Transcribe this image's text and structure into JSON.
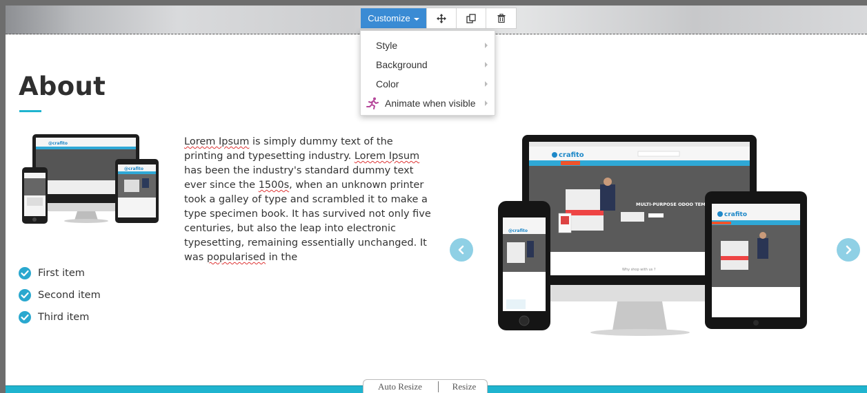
{
  "toolbar": {
    "customize_label": "Customize",
    "move_icon": "move-icon",
    "duplicate_icon": "duplicate-icon",
    "delete_icon": "trash-icon"
  },
  "customize_menu": {
    "items": [
      {
        "label": "Style"
      },
      {
        "label": "Background"
      },
      {
        "label": "Color"
      },
      {
        "label": "Animate when visible",
        "icon": "running-figure-icon"
      }
    ]
  },
  "about": {
    "title": "About",
    "body_segments": [
      {
        "text": "Lorem Ipsum",
        "misspelled": true
      },
      {
        "text": " is simply dummy text of the printing and typesetting industry. "
      },
      {
        "text": "Lorem Ipsum",
        "misspelled": true
      },
      {
        "text": " has been the industry's standard dummy text ever since the "
      },
      {
        "text": "1500s",
        "misspelled": true
      },
      {
        "text": ", when an unknown printer took a galley of type and scrambled it to make a type specimen book. It has survived not only five centuries, but also the leap into electronic typesetting, remaining essentially unchanged. It was "
      },
      {
        "text": "popularised",
        "misspelled": true
      },
      {
        "text": " in the"
      }
    ],
    "list": [
      "First item",
      "Second item",
      "Third item"
    ]
  },
  "carousel": {
    "prev_icon": "chevron-left-icon",
    "next_icon": "chevron-right-icon",
    "brand": "crafito",
    "hero_text": "MULTI-PURPOSE ODOO TEMP",
    "footer_text": "Why shop with us ?"
  },
  "resize": {
    "auto_label": "Auto Resize",
    "manual_label": "Resize"
  },
  "colors": {
    "accent": "#1fb4cf",
    "customize_button": "#3a8bd4",
    "arrow": "#8fd0e5",
    "check": "#2aa8cf"
  }
}
